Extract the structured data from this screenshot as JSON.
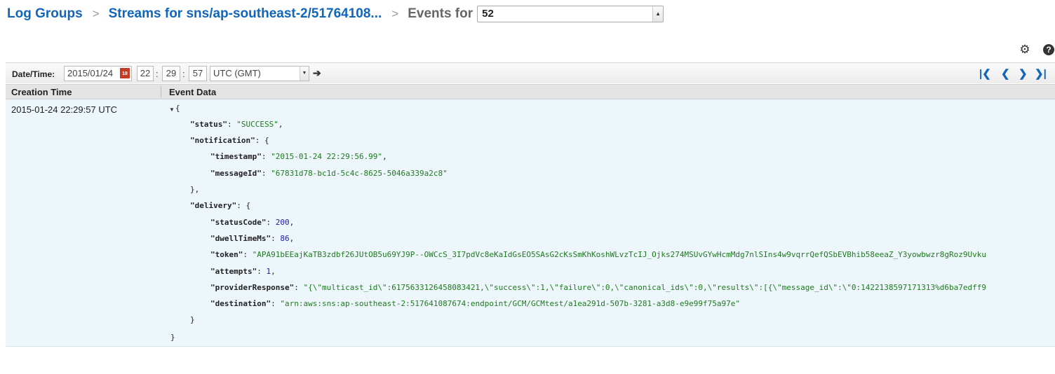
{
  "breadcrumb": {
    "log_groups": "Log Groups",
    "streams": "Streams for sns/ap-southeast-2/51764108...",
    "events_label": "Events for",
    "stream_value": "52"
  },
  "toolbar": {
    "date_label": "Date/Time:",
    "date": "2015/01/24",
    "hour": "22",
    "minute": "29",
    "second": "57",
    "timezone": "UTC (GMT)"
  },
  "columns": {
    "creation_time": "Creation Time",
    "event_data": "Event Data"
  },
  "event": {
    "creation_time": "2015-01-24 22:29:57 UTC",
    "open_brace": "{",
    "close_brace": "}",
    "status_key": "\"status\"",
    "status_val": "\"SUCCESS\"",
    "notification_key": "\"notification\"",
    "timestamp_key": "\"timestamp\"",
    "timestamp_val": "\"2015-01-24 22:29:56.99\"",
    "messageId_key": "\"messageId\"",
    "messageId_val": "\"67831d78-bc1d-5c4c-8625-5046a339a2c8\"",
    "delivery_key": "\"delivery\"",
    "statusCode_key": "\"statusCode\"",
    "statusCode_val": "200",
    "dwellTimeMs_key": "\"dwellTimeMs\"",
    "dwellTimeMs_val": "86",
    "token_key": "\"token\"",
    "token_val": "\"APA91bEEajKaTB3zdbf26JUtOB5u69YJ9P--OWCcS_3I7pdVc8eKaIdGsEO5SAsG2cKsSmKhKoshWLvzTcIJ_Ojks274MSUvGYwHcmMdg7nlSIns4w9vqrrQefQSbEVBhib58eeaZ_Y3yowbwzr8gRoz9Uvku",
    "attempts_key": "\"attempts\"",
    "attempts_val": "1",
    "providerResponse_key": "\"providerResponse\"",
    "providerResponse_val": "\"{\\\"multicast_id\\\":6175633126458083421,\\\"success\\\":1,\\\"failure\\\":0,\\\"canonical_ids\\\":0,\\\"results\\\":[{\\\"message_id\\\":\\\"0:1422138597171313%d6ba7edff9",
    "destination_key": "\"destination\"",
    "destination_val": "\"arn:aws:sns:ap-southeast-2:517641087674:endpoint/GCM/GCMtest/a1ea291d-507b-3281-a3d8-e9e99f75a97e\""
  },
  "icons": {
    "gear": "gear-icon",
    "help": "help-icon",
    "calendar": "calendar-icon",
    "go": "arrow-right-icon",
    "first": "first-page-icon",
    "prev": "prev-page-icon",
    "next": "next-page-icon",
    "last": "last-page-icon"
  },
  "colors": {
    "link": "#1166bb",
    "row_bg": "#edf6fb",
    "json_string": "#1f7a1f",
    "json_number": "#1a1aa6"
  }
}
